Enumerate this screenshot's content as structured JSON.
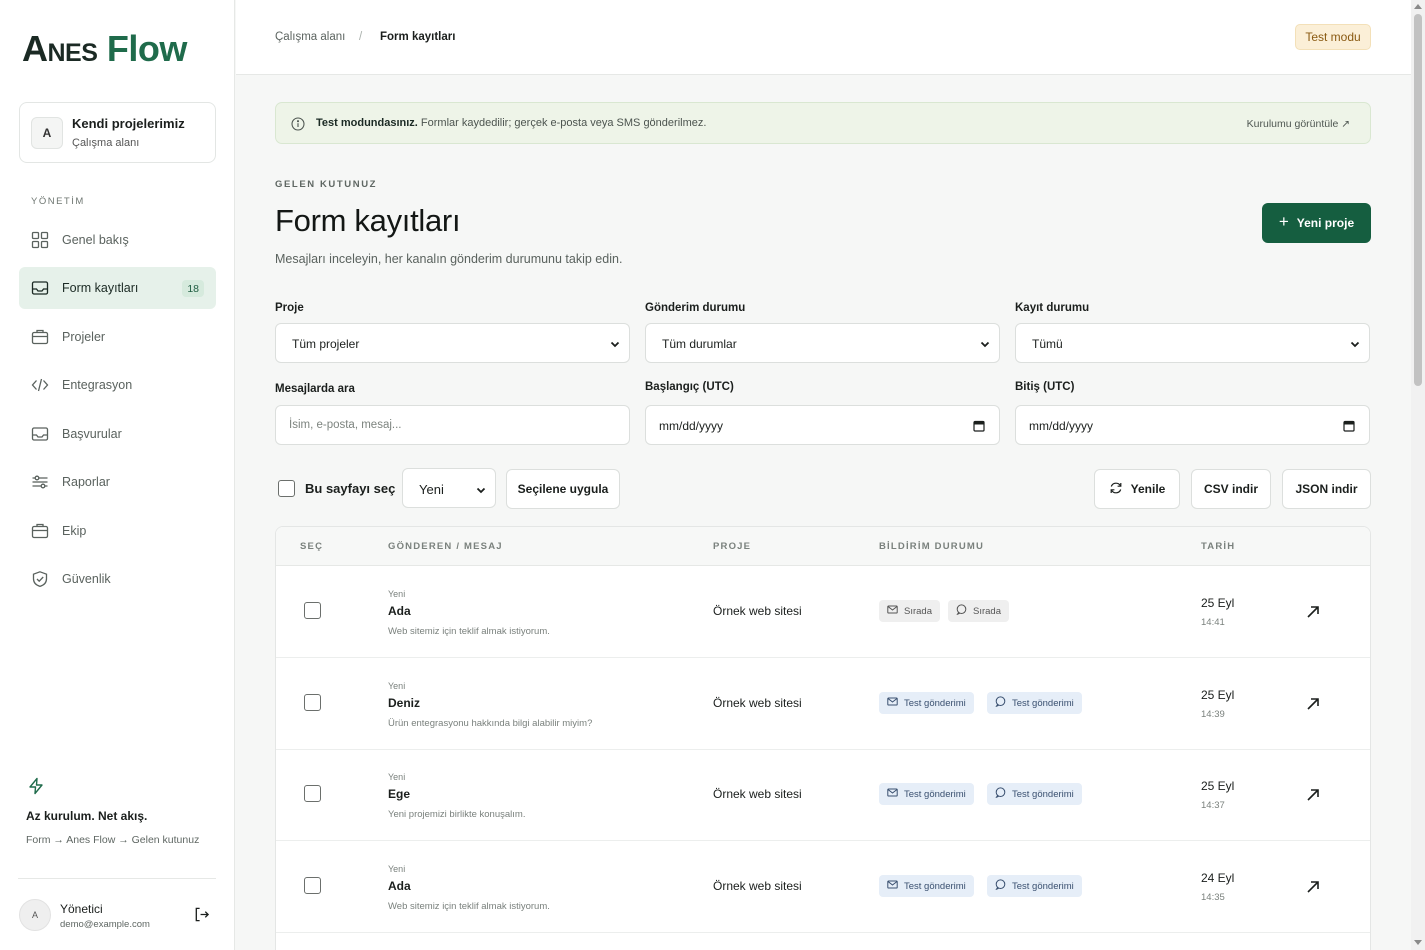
{
  "brand": {
    "name_part1": "Anes",
    "name_part2": "Flow",
    "accent": "#155e40"
  },
  "workspace": {
    "initial": "A",
    "title": "Kendi projelerimiz",
    "subtitle": "Çalışma alanı"
  },
  "sidebar": {
    "section_label": "YÖNETİM",
    "items": [
      {
        "label": "Genel bakış",
        "icon": "grid-icon",
        "active": false
      },
      {
        "label": "Form kayıtları",
        "icon": "inbox-icon",
        "active": true,
        "badge": "18"
      },
      {
        "label": "Projeler",
        "icon": "briefcase-icon",
        "active": false
      },
      {
        "label": "Entegrasyon",
        "icon": "code-icon",
        "active": false
      },
      {
        "label": "Başvurular",
        "icon": "inbox-icon",
        "active": false
      },
      {
        "label": "Raporlar",
        "icon": "sliders-icon",
        "active": false
      },
      {
        "label": "Ekip",
        "icon": "briefcase-icon",
        "active": false
      },
      {
        "label": "Güvenlik",
        "icon": "shield-icon",
        "active": false
      }
    ],
    "promo": {
      "icon": "bolt-icon",
      "title": "Az kurulum. Net akış.",
      "subtitle": "Form → Anes Flow → Gelen kutunuz"
    },
    "user": {
      "initial": "A",
      "name": "Yönetici",
      "email": "demo@example.com"
    }
  },
  "header": {
    "breadcrumb": [
      "Çalışma alanı",
      "Form kayıtları"
    ],
    "breadcrumb_sep": "/",
    "mode_badge": "Test modu"
  },
  "notice": {
    "strong": "Test modundasınız.",
    "text": " Formlar kaydedilir; gerçek e-posta veya SMS gönderilmez.",
    "link": "Kurulumu görüntüle ↗"
  },
  "main": {
    "eyebrow": "GELEN KUTUNUZ",
    "title": "Form kayıtları",
    "subtitle": "Mesajları inceleyin, her kanalın gönderim durumunu takip edin.",
    "new_button": "Yeni proje"
  },
  "filters": {
    "project": {
      "label": "Proje",
      "value": "Tüm projeler"
    },
    "delivery": {
      "label": "Gönderim durumu",
      "value": "Tüm durumlar"
    },
    "record": {
      "label": "Kayıt durumu",
      "value": "Tümü"
    },
    "search": {
      "label": "Mesajlarda ara",
      "placeholder": "İsim, e-posta, mesaj..."
    },
    "start": {
      "label": "Başlangıç (UTC)",
      "value": "mm/dd/yyyy"
    },
    "end": {
      "label": "Bitiş (UTC)",
      "value": "mm/dd/yyyy"
    }
  },
  "bulk": {
    "select_page": "Bu sayfayı seç",
    "status_value": "Yeni",
    "apply": "Seçilene uygula",
    "refresh": "Yenile",
    "csv": "CSV indir",
    "json": "JSON indir"
  },
  "table": {
    "columns": [
      "SEÇ",
      "GÖNDEREN / MESAJ",
      "PROJE",
      "BİLDİRİM DURUMU",
      "TARİH"
    ],
    "rows": [
      {
        "status": "Yeni",
        "name": "Ada",
        "message": "Web sitemiz için teklif almak istiyorum.",
        "project": "Örnek web sitesi",
        "email_status": "Sırada",
        "sms_status": "Sırada",
        "date": "25 Eyl",
        "time": "14:41"
      },
      {
        "status": "Yeni",
        "name": "Deniz",
        "message": "Ürün entegrasyonu hakkında bilgi alabilir miyim?",
        "project": "Örnek web sitesi",
        "email_status": "Test gönderimi",
        "sms_status": "Test gönderimi",
        "date": "25 Eyl",
        "time": "14:39"
      },
      {
        "status": "Yeni",
        "name": "Ege",
        "message": "Yeni projemizi birlikte konuşalım.",
        "project": "Örnek web sitesi",
        "email_status": "Test gönderimi",
        "sms_status": "Test gönderimi",
        "date": "25 Eyl",
        "time": "14:37"
      },
      {
        "status": "Yeni",
        "name": "Ada",
        "message": "Web sitemiz için teklif almak istiyorum.",
        "project": "Örnek web sitesi",
        "email_status": "Test gönderimi",
        "sms_status": "Test gönderimi",
        "date": "24 Eyl",
        "time": "14:35"
      }
    ]
  }
}
